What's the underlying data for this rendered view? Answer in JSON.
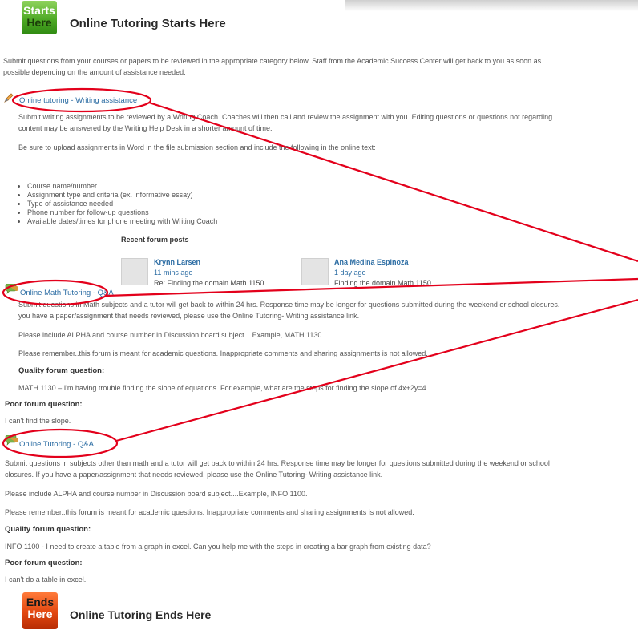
{
  "header": {
    "start_badge_line1": "Starts",
    "start_badge_line2": "Here",
    "title": "Online Tutoring Starts Here"
  },
  "intro": {
    "line1": "Submit questions from your courses or papers to be reviewed in the appropriate category below.  Staff from the Academic Success Center will get back to you as soon as",
    "line2": "possible depending on the amount of assistance needed."
  },
  "writing": {
    "link": "Online tutoring - Writing assistance",
    "desc_line1": "Submit writing assignments to be reviewed by a Writing Coach.  Coaches will then call and review the assignment with you.  Editing questions or questions not regarding",
    "desc_line2": "content may be answered by the Writing Help Desk in a shorter amount of time.",
    "upload_note": "Be sure to upload assignments in Word in the file submission section and include the following in the online text:",
    "bullets": [
      "Course name/number",
      "Assignment type and criteria (ex. informative essay)",
      "Type of assistance needed",
      "Phone number for follow-up questions",
      "Available dates/times for phone meeting with Writing Coach"
    ]
  },
  "recent_posts": {
    "heading": "Recent forum posts",
    "posts": [
      {
        "author": "Krynn Larsen",
        "time": "11 mins ago",
        "subject": "Re: Finding the domain Math 1150"
      },
      {
        "author": "Ana Medina Espinoza",
        "time": "1 day ago",
        "subject": "Finding the domain Math 1150"
      }
    ]
  },
  "math": {
    "link": "Online Math Tutoring - Q&A",
    "desc_line1": "Submit questions in Math subjects and a tutor will get back to within 24 hrs.  Response time may be longer for questions submitted during the weekend or school closures.",
    "desc_line2": "you have a paper/assignment that needs reviewed, please use the Online Tutoring- Writing assistance link.",
    "include_note": "Please include ALPHA and course number in Discussion board subject....Example, MATH 1130.",
    "remember_note": "Please remember..this forum is meant for academic questions.  Inappropriate comments and sharing assignments is not allowed.",
    "quality_heading": "Quality forum question:",
    "quality_example": "MATH 1130 – I'm having trouble finding the slope of equations.  For example, what are the steps for finding the slope of 4x+2y=4",
    "poor_heading": "Poor forum question:",
    "poor_example": "I can't find the slope."
  },
  "general": {
    "link": "Online Tutoring - Q&A",
    "desc_line1": "Submit questions in subjects other than math and a tutor will get back to within 24 hrs.  Response time may be longer for questions submitted during the weekend or school",
    "desc_line2": "closures.  If you have a paper/assignment that needs reviewed, please use the Online Tutoring- Writing assistance link.",
    "include_note": "Please include ALPHA and course number in Discussion board subject....Example, INFO 1100.",
    "remember_note": "Please remember..this forum is meant for academic questions.  Inappropriate comments and sharing assignments is not allowed.",
    "quality_heading": "Quality forum question:",
    "quality_example": "INFO 1100 - I need to create a table from a graph in excel.  Can you help me with the steps in creating a bar graph from existing data?",
    "poor_heading": "Poor forum question:",
    "poor_example": "I can't do a table in excel."
  },
  "footer": {
    "end_badge_line1": "Ends",
    "end_badge_line2": "Here",
    "title": "Online Tutoring Ends Here"
  },
  "icons": {
    "writing_icon": "pencil-icon",
    "forum_icon": "forum-icon"
  },
  "colors": {
    "link": "#2b6ca3",
    "annotation": "#e3001b",
    "start_badge": "#4faa26",
    "end_badge": "#e24710"
  }
}
